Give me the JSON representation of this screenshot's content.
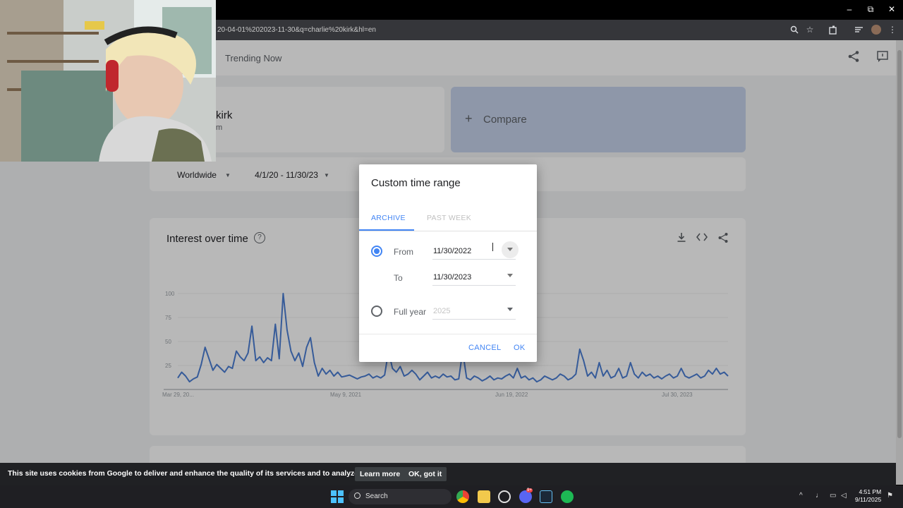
{
  "browser": {
    "url": "20-04-01%202023-11-30&q=charlie%20kirk&hl=en",
    "controls": {
      "minimize": "–",
      "maximize": "⧉",
      "close": "✕"
    }
  },
  "header": {
    "trending": "Trending Now"
  },
  "term_card": {
    "name": "kirk",
    "subtitle": "m"
  },
  "compare": {
    "plus": "+",
    "label": "Compare"
  },
  "filters": {
    "region": "Worldwide",
    "range": "4/1/20 - 11/30/23"
  },
  "chart_card": {
    "title": "Interest over time",
    "help": "?"
  },
  "chart_data": {
    "type": "line",
    "y_ticks": [
      "100",
      "75",
      "50",
      "25"
    ],
    "ylim": [
      0,
      100
    ],
    "x_ticks": [
      "Mar 29, 20...",
      "May 9, 2021",
      "Jun 19, 2022",
      "Jul 30, 2023"
    ],
    "series": [
      {
        "color": "#4c7ed4",
        "values": [
          12,
          18,
          14,
          8,
          11,
          13,
          26,
          44,
          32,
          20,
          26,
          22,
          18,
          24,
          22,
          40,
          34,
          30,
          38,
          66,
          30,
          34,
          28,
          33,
          30,
          68,
          32,
          100,
          62,
          40,
          30,
          38,
          24,
          44,
          54,
          28,
          14,
          22,
          16,
          20,
          14,
          18,
          13,
          14,
          15,
          13,
          11,
          13,
          14,
          16,
          12,
          14,
          12,
          15,
          40,
          22,
          18,
          24,
          14,
          16,
          20,
          16,
          10,
          14,
          18,
          12,
          14,
          12,
          16,
          13,
          14,
          10,
          11,
          40,
          12,
          10,
          14,
          12,
          9,
          11,
          14,
          10,
          12,
          11,
          14,
          16,
          12,
          22,
          12,
          14,
          10,
          12,
          8,
          10,
          14,
          12,
          10,
          12,
          16,
          14,
          10,
          12,
          16,
          42,
          30,
          14,
          18,
          12,
          28,
          14,
          20,
          12,
          14,
          22,
          12,
          14,
          28,
          16,
          12,
          18,
          14,
          16,
          12,
          14,
          11,
          14,
          16,
          12,
          14,
          22,
          14,
          12,
          14,
          16,
          12,
          14,
          20,
          16,
          22,
          16,
          18,
          14
        ]
      }
    ]
  },
  "dialog": {
    "title": "Custom time range",
    "tabs": [
      "ARCHIVE",
      "PAST WEEK"
    ],
    "from_label": "From",
    "from_value": "11/30/2022",
    "to_label": "To",
    "to_value": "11/30/2023",
    "full_year_label": "Full year",
    "full_year_value": "2025",
    "cancel": "CANCEL",
    "ok": "OK"
  },
  "cookie_bar": {
    "text": "This site uses cookies from Google to deliver and enhance the quality of its services and to analyze traffic.",
    "learn_more": "Learn more",
    "ok": "OK, got it"
  },
  "taskbar": {
    "search": "Search",
    "time": "4:51 PM",
    "date": "9/11/2025",
    "discord_badge": "9+"
  }
}
